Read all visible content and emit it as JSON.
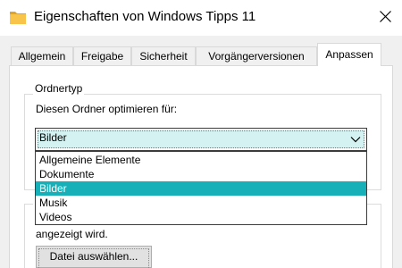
{
  "window": {
    "title": "Eigenschaften von Windows Tipps 11",
    "icon": "folder-icon",
    "close_icon": "close-icon"
  },
  "tabs": [
    {
      "label": "Allgemein",
      "active": false
    },
    {
      "label": "Freigabe",
      "active": false
    },
    {
      "label": "Sicherheit",
      "active": false
    },
    {
      "label": "Vorgängerversionen",
      "active": false
    },
    {
      "label": "Anpassen",
      "active": true
    }
  ],
  "folder_type": {
    "group_label": "Ordnertyp",
    "optimize_label": "Diesen Ordner optimieren für:",
    "selected_value": "Bilder",
    "dropdown_icon": "chevron-down-icon",
    "options": [
      {
        "label": "Allgemeine Elemente",
        "selected": false
      },
      {
        "label": "Dokumente",
        "selected": false
      },
      {
        "label": "Bilder",
        "selected": true
      },
      {
        "label": "Musik",
        "selected": false
      },
      {
        "label": "Videos",
        "selected": false
      }
    ]
  },
  "folder_picture": {
    "hint_text": "angezeigt wird.",
    "choose_file_button": "Datei auswählen..."
  },
  "colors": {
    "selection": "#17b0b8",
    "combo_focus_fill": "#d4f2f2",
    "folder_yellow": "#f8c44a"
  }
}
